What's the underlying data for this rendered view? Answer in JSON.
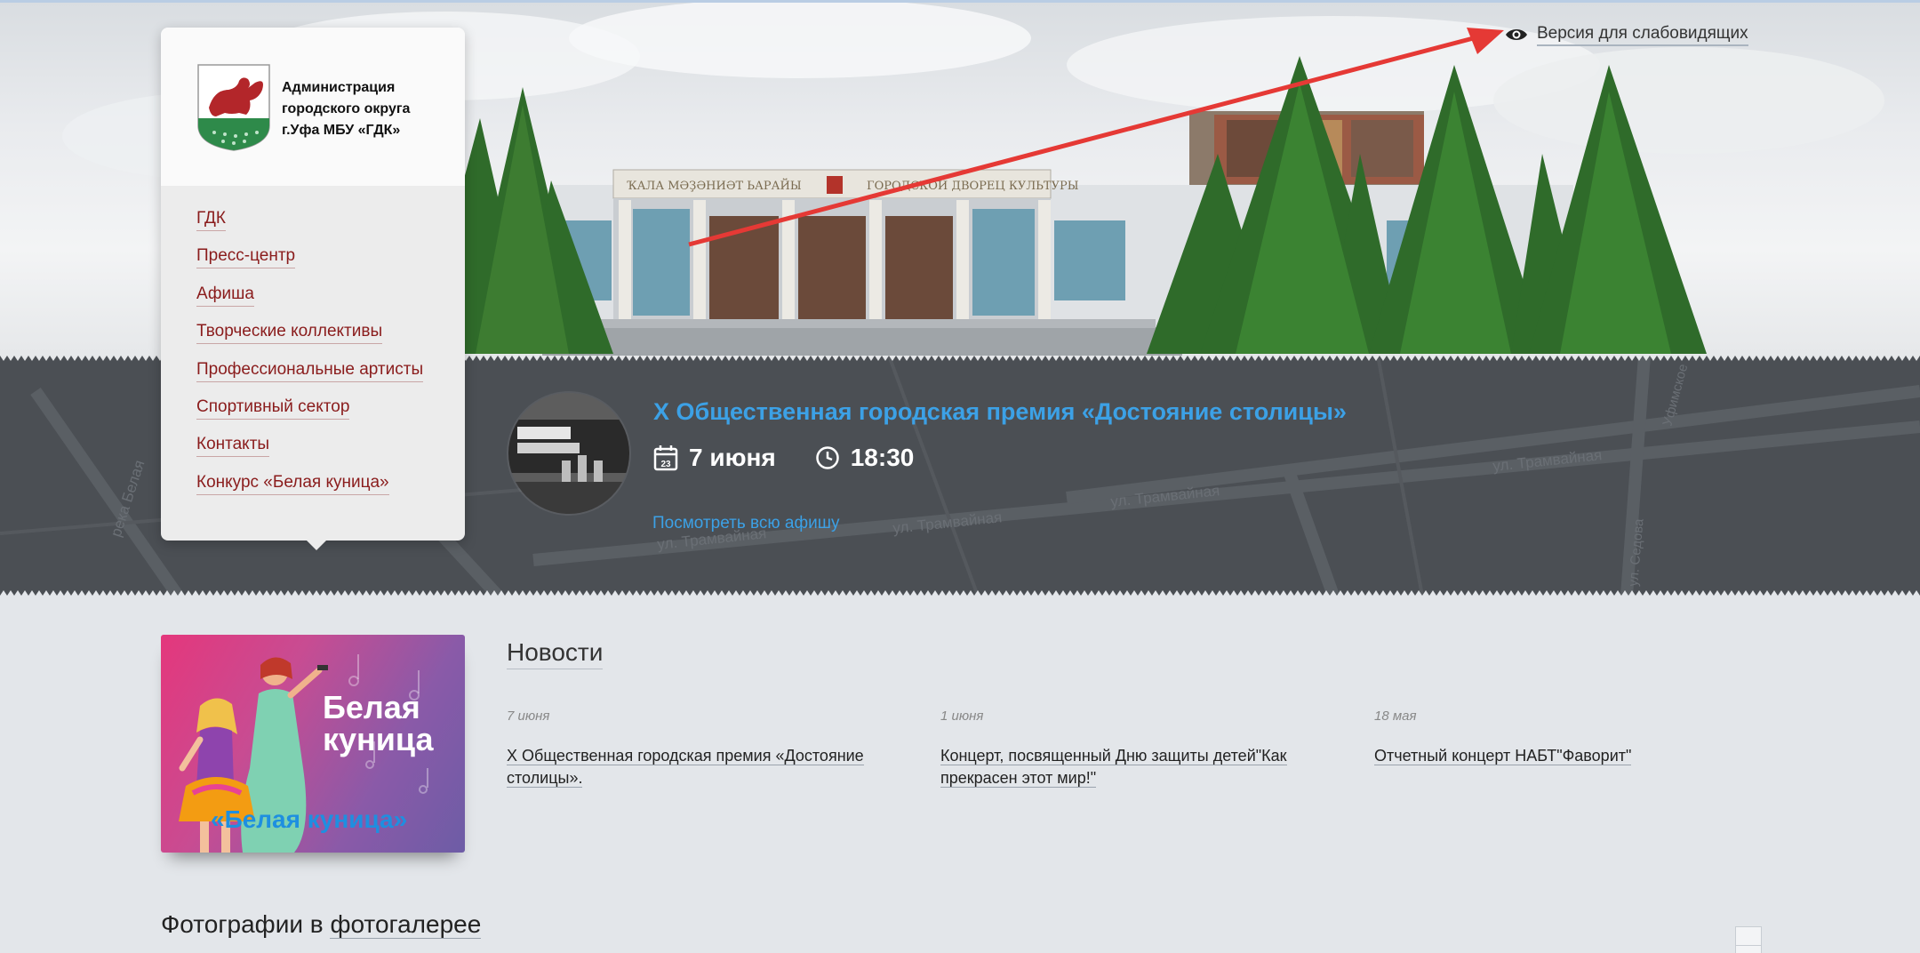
{
  "accessibility": {
    "label": "Версия для слабовидящих",
    "icon": "eye-icon"
  },
  "hero": {
    "building_sign_left": "ҠАЛА МӘҘӘНИӘТ ЬАРАЙЫ",
    "building_sign_right": "ГОРОДСКОЙ ДВОРЕЦ КУЛЬТУРЫ"
  },
  "organization": {
    "name_line1": "Администрация",
    "name_line2": "городского округа",
    "name_line3": "г.Уфа МБУ «ГДК»"
  },
  "menu": {
    "items": [
      {
        "label": "ГДК"
      },
      {
        "label": "Пресс-центр"
      },
      {
        "label": "Афиша"
      },
      {
        "label": "Творческие коллективы"
      },
      {
        "label": "Профессиональные артисты"
      },
      {
        "label": "Спортивный сектор"
      },
      {
        "label": "Контакты"
      },
      {
        "label": "Конкурс «Белая куница»"
      }
    ]
  },
  "event": {
    "title": "X Общественная городская премия «Достояние столицы»",
    "date": "7 июня",
    "calendar_day": "23",
    "time": "18:30",
    "all_link": "Посмотреть всю афишу"
  },
  "map": {
    "street1": "ул. Трамвайная",
    "street2": "ул. Трамвайная",
    "street3": "ул. Трамвайная",
    "street4": "ул. Трамвайная",
    "river": "река Белая",
    "street_ufimskoe": "Уфимское",
    "street_sedova": "ул. Седова"
  },
  "promo": {
    "title_line1": "Белая",
    "title_line2": "куница",
    "subtitle": "«Белая куница»"
  },
  "news": {
    "title": "Новости",
    "items": [
      {
        "date": "7 июня",
        "title_line1": "X Общественная городская премия «Достояние",
        "title_line2": "столицы»."
      },
      {
        "date": "1 июня",
        "title_line1": "Концерт, посвященный Дню защиты детей\"Как",
        "title_line2": "прекрасен этот мир!\""
      },
      {
        "date": "18 мая",
        "title_line1": "Отчетный концерт НАБТ\"Фаворит\"",
        "title_line2": ""
      }
    ]
  },
  "gallery": {
    "title_part1": "Фотографии в",
    "title_part2": "фотогалерее"
  },
  "colors": {
    "accent_blue": "#3ca1e6",
    "menu_link": "#8a1c1c",
    "band": "#4b4f54",
    "arrow": "#e53935"
  }
}
